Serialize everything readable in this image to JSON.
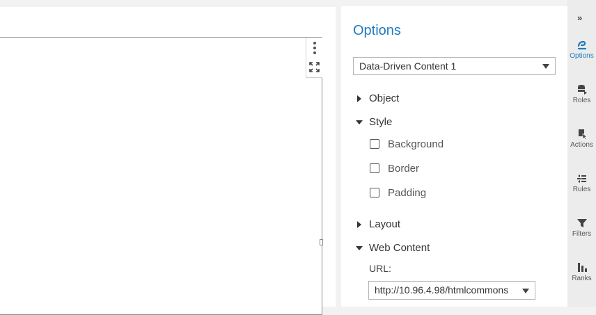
{
  "options": {
    "title": "Options",
    "object_selector": "Data-Driven Content 1",
    "sections": {
      "object": "Object",
      "style": "Style",
      "layout": "Layout",
      "web_content": "Web Content"
    },
    "style_checkboxes": [
      {
        "label": "Background",
        "checked": false
      },
      {
        "label": "Border",
        "checked": false
      },
      {
        "label": "Padding",
        "checked": false
      }
    ],
    "url_label": "URL:",
    "url_value": "http://10.96.4.98/htmlcommons"
  },
  "rail": {
    "collapse": "»",
    "items": [
      {
        "label": "Options",
        "icon": "options-icon",
        "active": true
      },
      {
        "label": "Roles",
        "icon": "roles-icon"
      },
      {
        "label": "Actions",
        "icon": "actions-icon"
      },
      {
        "label": "Rules",
        "icon": "rules-icon"
      },
      {
        "label": "Filters",
        "icon": "filter-icon"
      },
      {
        "label": "Ranks",
        "icon": "ranks-icon"
      }
    ]
  },
  "colors": {
    "accent": "#1f7bbf",
    "rail_bg": "#ececec",
    "background": "#f2f2f2"
  }
}
